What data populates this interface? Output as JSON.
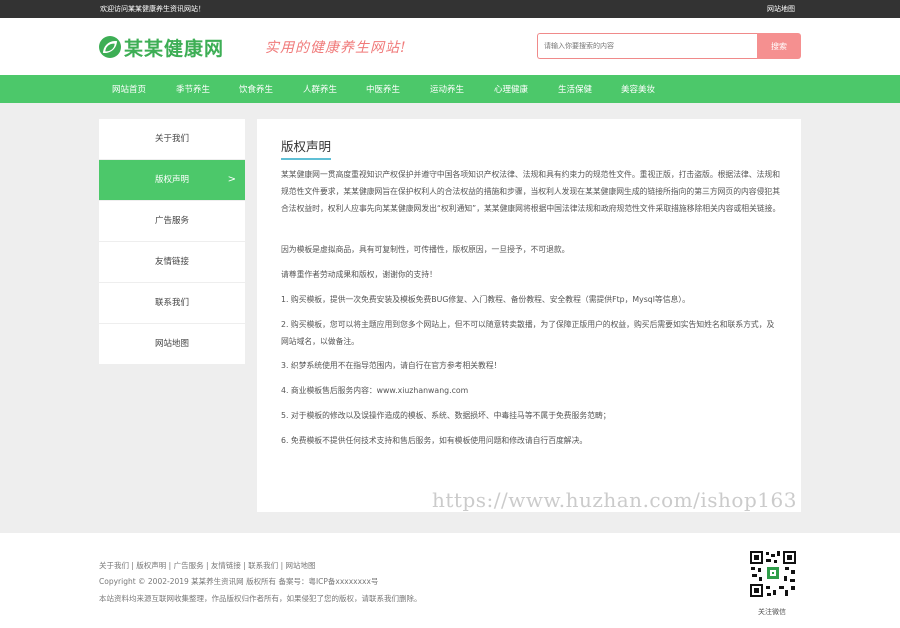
{
  "topbar": {
    "welcome": "欢迎访问某某健康养生资讯网站！",
    "sitemap": "网站地图"
  },
  "header": {
    "logo_text": "某某健康网",
    "slogan": "实用的健康养生网站!",
    "search_placeholder": "请输入你要搜索的内容",
    "search_button": "搜索"
  },
  "nav": {
    "items": [
      "网站首页",
      "季节养生",
      "饮食养生",
      "人群养生",
      "中医养生",
      "运动养生",
      "心理健康",
      "生活保健",
      "美容美妆"
    ]
  },
  "sidebar": {
    "items": [
      {
        "label": "关于我们"
      },
      {
        "label": "版权声明",
        "chevron": ">"
      },
      {
        "label": "广告服务"
      },
      {
        "label": "友情链接"
      },
      {
        "label": "联系我们"
      },
      {
        "label": "网站地图"
      }
    ],
    "active_index": 1
  },
  "content": {
    "title": "版权声明",
    "paragraphs": [
      "某某健康网一贯高度重视知识产权保护并遵守中国各项知识产权法律、法规和具有约束力的规范性文件。重视正版，打击盗版。根据法律、法规和规范性文件要求，某某健康网旨在保护权利人的合法权益的措施和步骤，当权利人发现在某某健康网生成的链接所指向的第三方网页的内容侵犯其合法权益时，权利人应事先向某某健康网发出“权利通知”，某某健康网将根据中国法律法规和政府规范性文件采取措施移除相关内容或相关链接。",
      "因为模板是虚拟商品，具有可复制性，可传播性，版权原因，一旦授予，不可退款。",
      "请尊重作者劳动成果和版权，谢谢你的支持！",
      "1. 购买模板，提供一次免费安装及模板免费BUG修复、入门教程、备份教程、安全教程（需提供Ftp，Mysql等信息）。",
      "2. 购买模板，您可以将主题应用到您多个网站上，但不可以随意转卖散播，为了保障正版用户的权益，购买后需要如实告知姓名和联系方式，及网站域名，以做备注。",
      "3. 织梦系统使用不在指导范围内，请自行在官方参考相关教程！",
      "4. 商业模板售后服务内容：www.xiuzhanwang.com",
      "5. 对于模板的修改以及误操作造成的模板、系统、数据损坏、中毒挂马等不属于免费服务范畴；",
      "6. 免费模板不提供任何技术支持和售后服务，如有模板使用问题和修改请自行百度解决。"
    ]
  },
  "watermark": "https://www.huzhan.com/ishop163",
  "footer": {
    "links": "关于我们 | 版权声明 | 广告服务 | 友情链接 | 联系我们 | 网站地图",
    "copyright": "Copyright © 2002-2019 某某养生资讯网 版权所有 备案号：粤ICP备xxxxxxxx号",
    "note": "本站资料均来源互联网收集整理，作品版权归作者所有，如果侵犯了您的版权，请联系我们删除。",
    "qr_label": "关注微信"
  },
  "colors": {
    "brand_green": "#4cc86a",
    "accent_pink": "#f59090",
    "title_underline": "#5fbfd5"
  }
}
